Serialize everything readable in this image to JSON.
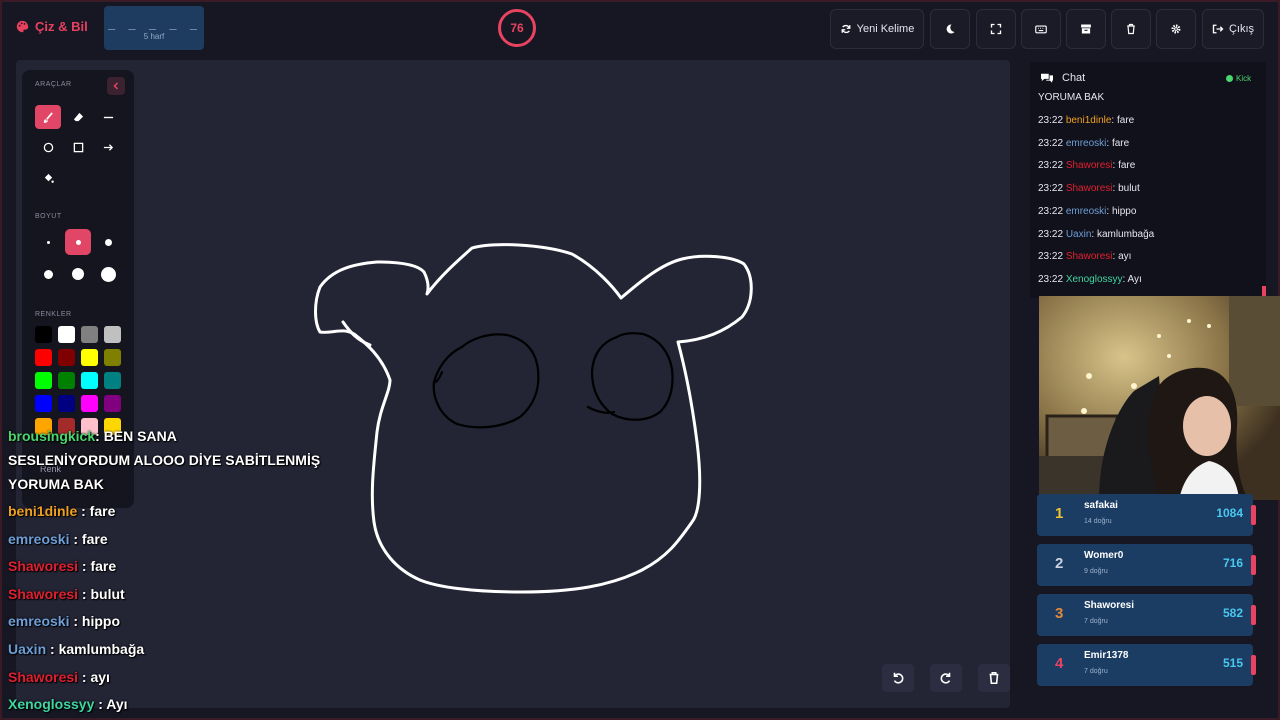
{
  "header": {
    "brand": "Çiz & Bil",
    "word_mask": "_ _ _ _ _",
    "letter_count": "5 harf",
    "timer": "76",
    "new_word": "Yeni Kelime",
    "exit": "Çıkış"
  },
  "tools": {
    "tools_label": "ARAÇLAR",
    "size_label": "BOYUT",
    "colors_label": "RENKLER",
    "color_hint": "Renk",
    "colors": [
      "#000000",
      "#ffffff",
      "#808080",
      "#c0c0c0",
      "#ff0000",
      "#800000",
      "#ffff00",
      "#808000",
      "#00ff00",
      "#008000",
      "#00ffff",
      "#008080",
      "#0000ff",
      "#000080",
      "#ff00ff",
      "#800080",
      "#ffa500",
      "#a52a2a",
      "#ffc0cb",
      "#ffd700"
    ]
  },
  "overlay_chat": [
    {
      "user": "brousingkick",
      "user_color": "#4ad66d",
      "msg": ": BEN SANA"
    },
    {
      "user": "",
      "user_color": "#ffffff",
      "msg": "SESLENİYORDUM ALOOO DİYE SABİTLENMİŞ"
    },
    {
      "user": "",
      "user_color": "#ffffff",
      "msg": "YORUMA BAK"
    },
    {
      "user": "beni1dinle",
      "user_color": "#f0a020",
      "msg": " : fare"
    },
    {
      "user": "emreoski",
      "user_color": "#6e9fd8",
      "msg": " : fare"
    },
    {
      "user": "Shaworesi",
      "user_color": "#e02030",
      "msg": " : fare"
    },
    {
      "user": "Shaworesi",
      "user_color": "#e02030",
      "msg": " : bulut"
    },
    {
      "user": "emreoski",
      "user_color": "#6e9fd8",
      "msg": " : hippo"
    },
    {
      "user": "Uaxin",
      "user_color": "#6e9fd8",
      "msg": " : kamlumbağa"
    },
    {
      "user": "Shaworesi",
      "user_color": "#e02030",
      "msg": " : ayı"
    },
    {
      "user": "Xenoglossyy",
      "user_color": "#3fd6a0",
      "msg": " : Ayı"
    }
  ],
  "chat": {
    "title": "Chat",
    "platform": "Kick",
    "first_line": "YORUMA BAK",
    "messages": [
      {
        "time": "23:22",
        "user": "beni1dinle",
        "user_color": "#f0a020",
        "msg": ": fare"
      },
      {
        "time": "23:22",
        "user": "emreoski",
        "user_color": "#6e9fd8",
        "msg": ": fare"
      },
      {
        "time": "23:22",
        "user": "Shaworesi",
        "user_color": "#e02030",
        "msg": ": fare"
      },
      {
        "time": "23:22",
        "user": "Shaworesi",
        "user_color": "#e02030",
        "msg": ": bulut"
      },
      {
        "time": "23:22",
        "user": "emreoski",
        "user_color": "#6e9fd8",
        "msg": ": hippo"
      },
      {
        "time": "23:22",
        "user": "Uaxin",
        "user_color": "#6e9fd8",
        "msg": ": kamlumbağa"
      },
      {
        "time": "23:22",
        "user": "Shaworesi",
        "user_color": "#e02030",
        "msg": ": ayı"
      },
      {
        "time": "23:22",
        "user": "Xenoglossyy",
        "user_color": "#3fd6a0",
        "msg": ": Ayı"
      }
    ]
  },
  "leaderboard": [
    {
      "rank": "1",
      "rank_color": "#f2c230",
      "name": "safakai",
      "correct": "14 doğru",
      "score": "1084"
    },
    {
      "rank": "2",
      "rank_color": "#c9d2de",
      "name": "Womer0",
      "correct": "9 doğru",
      "score": "716"
    },
    {
      "rank": "3",
      "rank_color": "#e08a3a",
      "name": "Shaworesi",
      "correct": "7 doğru",
      "score": "582"
    },
    {
      "rank": "4",
      "rank_color": "#e84361",
      "name": "Emir1378",
      "correct": "7 doğru",
      "score": "515"
    }
  ]
}
